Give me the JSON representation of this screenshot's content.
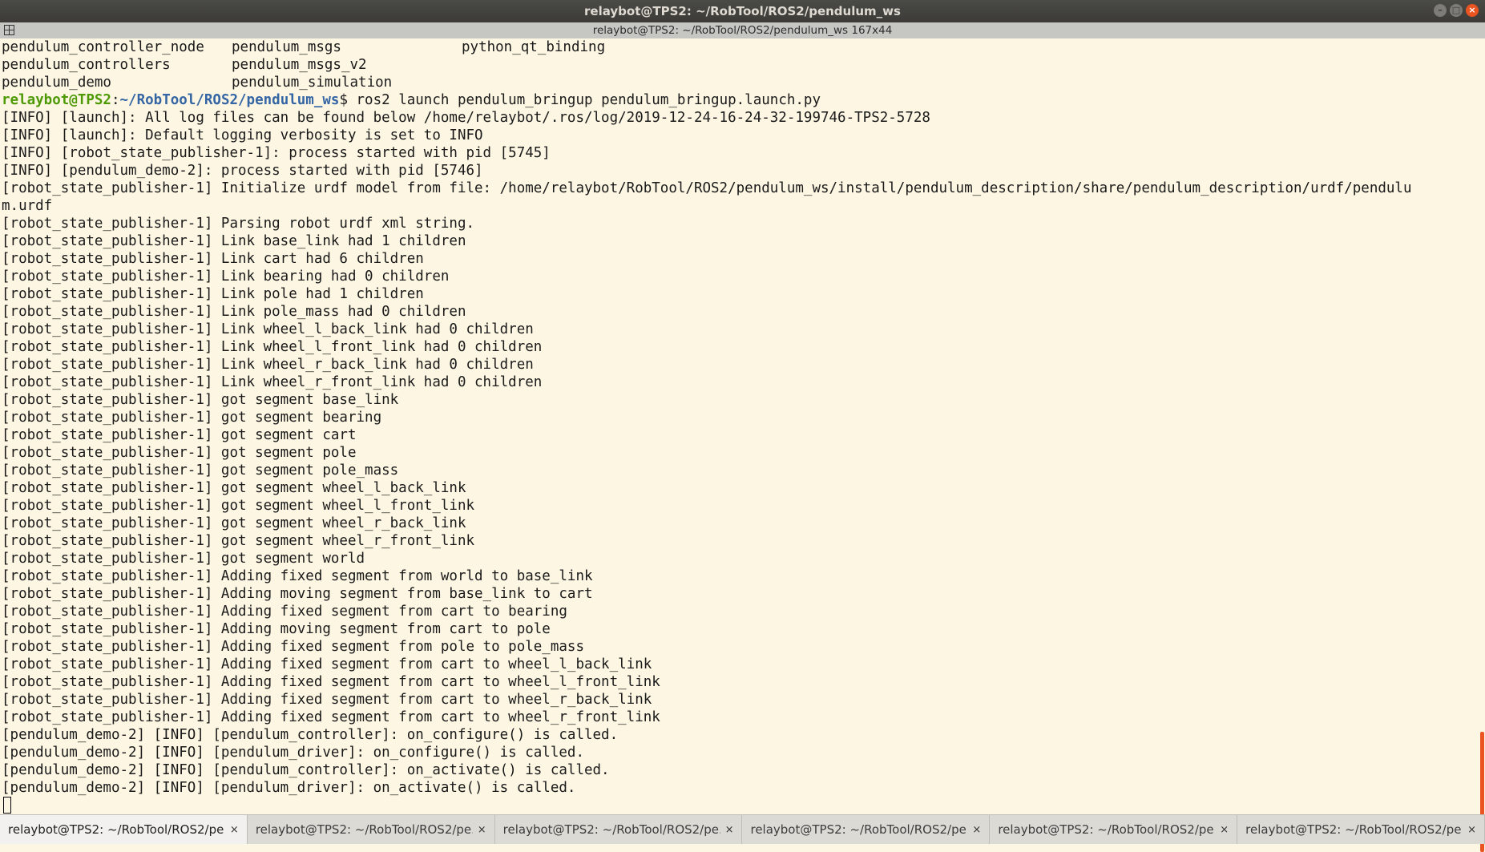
{
  "window": {
    "title": "relaybot@TPS2: ~/RobTool/ROS2/pendulum_ws",
    "min_glyph": "–",
    "max_glyph": "□",
    "close_glyph": "×"
  },
  "pane": {
    "title": "relaybot@TPS2: ~/RobTool/ROS2/pendulum_ws 167x44"
  },
  "terminal": {
    "ls_rows": [
      [
        "pendulum_controller_node",
        "pendulum_msgs",
        "python_qt_binding"
      ],
      [
        "pendulum_controllers",
        "pendulum_msgs_v2",
        ""
      ],
      [
        "pendulum_demo",
        "pendulum_simulation",
        ""
      ]
    ],
    "prompt_user": "relaybot@TPS2",
    "prompt_sep": ":",
    "prompt_path": "~/RobTool/ROS2/pendulum_ws",
    "prompt_command": "$ ros2 launch pendulum_bringup pendulum_bringup.launch.py",
    "output": [
      "[INFO] [launch]: All log files can be found below /home/relaybot/.ros/log/2019-12-24-16-24-32-199746-TPS2-5728",
      "[INFO] [launch]: Default logging verbosity is set to INFO",
      "[INFO] [robot_state_publisher-1]: process started with pid [5745]",
      "[INFO] [pendulum_demo-2]: process started with pid [5746]",
      "[robot_state_publisher-1] Initialize urdf model from file: /home/relaybot/RobTool/ROS2/pendulum_ws/install/pendulum_description/share/pendulum_description/urdf/pendulu",
      "m.urdf",
      "[robot_state_publisher-1] Parsing robot urdf xml string.",
      "[robot_state_publisher-1] Link base_link had 1 children",
      "[robot_state_publisher-1] Link cart had 6 children",
      "[robot_state_publisher-1] Link bearing had 0 children",
      "[robot_state_publisher-1] Link pole had 1 children",
      "[robot_state_publisher-1] Link pole_mass had 0 children",
      "[robot_state_publisher-1] Link wheel_l_back_link had 0 children",
      "[robot_state_publisher-1] Link wheel_l_front_link had 0 children",
      "[robot_state_publisher-1] Link wheel_r_back_link had 0 children",
      "[robot_state_publisher-1] Link wheel_r_front_link had 0 children",
      "[robot_state_publisher-1] got segment base_link",
      "[robot_state_publisher-1] got segment bearing",
      "[robot_state_publisher-1] got segment cart",
      "[robot_state_publisher-1] got segment pole",
      "[robot_state_publisher-1] got segment pole_mass",
      "[robot_state_publisher-1] got segment wheel_l_back_link",
      "[robot_state_publisher-1] got segment wheel_l_front_link",
      "[robot_state_publisher-1] got segment wheel_r_back_link",
      "[robot_state_publisher-1] got segment wheel_r_front_link",
      "[robot_state_publisher-1] got segment world",
      "[robot_state_publisher-1] Adding fixed segment from world to base_link",
      "[robot_state_publisher-1] Adding moving segment from base_link to cart",
      "[robot_state_publisher-1] Adding fixed segment from cart to bearing",
      "[robot_state_publisher-1] Adding moving segment from cart to pole",
      "[robot_state_publisher-1] Adding fixed segment from pole to pole_mass",
      "[robot_state_publisher-1] Adding fixed segment from cart to wheel_l_back_link",
      "[robot_state_publisher-1] Adding fixed segment from cart to wheel_l_front_link",
      "[robot_state_publisher-1] Adding fixed segment from cart to wheel_r_back_link",
      "[robot_state_publisher-1] Adding fixed segment from cart to wheel_r_front_link",
      "[pendulum_demo-2] [INFO] [pendulum_controller]: on_configure() is called.",
      "[pendulum_demo-2] [INFO] [pendulum_driver]: on_configure() is called.",
      "[pendulum_demo-2] [INFO] [pendulum_controller]: on_activate() is called.",
      "[pendulum_demo-2] [INFO] [pendulum_driver]: on_activate() is called."
    ]
  },
  "tabs": [
    {
      "label": "relaybot@TPS2: ~/RobTool/ROS2/pe...",
      "close": "×",
      "active": true
    },
    {
      "label": "relaybot@TPS2: ~/RobTool/ROS2/pe...",
      "close": "×",
      "active": false
    },
    {
      "label": "relaybot@TPS2: ~/RobTool/ROS2/pe...",
      "close": "×",
      "active": false
    },
    {
      "label": "relaybot@TPS2: ~/RobTool/ROS2/pe...",
      "close": "×",
      "active": false
    },
    {
      "label": "relaybot@TPS2: ~/RobTool/ROS2/pe...",
      "close": "×",
      "active": false
    },
    {
      "label": "relaybot@TPS2: ~/RobTool/ROS2/pe...",
      "close": "×",
      "active": false
    }
  ],
  "colors": {
    "terminal_bg": "#fdf6e3",
    "prompt_user": "#4e9a06",
    "prompt_path": "#3465a4",
    "close_button": "#e95420",
    "scroll_thumb": "#e95420"
  }
}
